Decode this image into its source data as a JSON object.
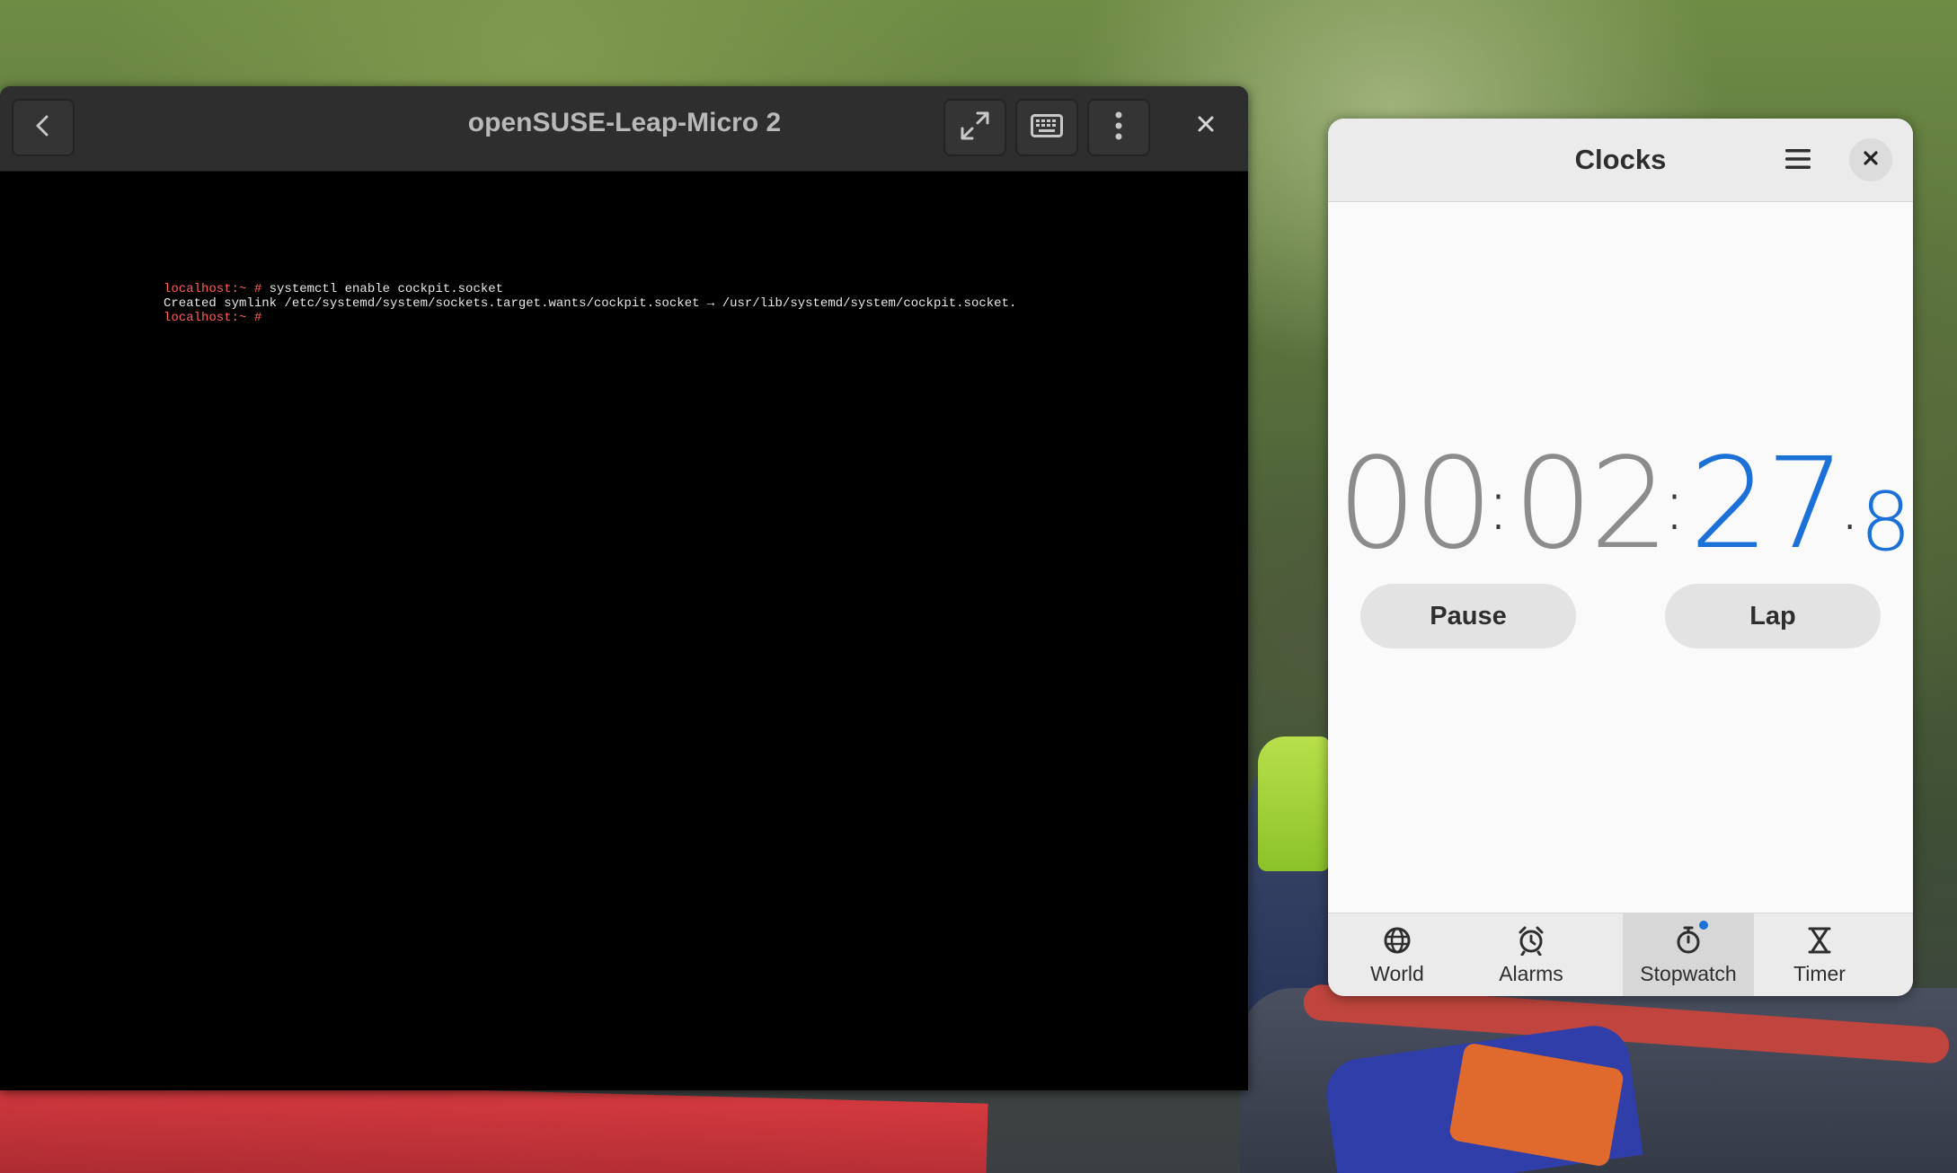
{
  "vm_window": {
    "title": "openSUSE-Leap-Micro 2",
    "terminal": {
      "line1_prompt": "localhost:~ #",
      "line1_command": " systemctl enable cockpit.socket",
      "line2": "Created symlink /etc/systemd/system/sockets.target.wants/cockpit.socket → /usr/lib/systemd/system/cockpit.socket.",
      "line3_prompt": "localhost:~ #"
    },
    "icons": {
      "back": "chevron-left-icon",
      "fullscreen": "fullscreen-icon",
      "keyboard": "keyboard-icon",
      "menu": "kebab-menu-icon",
      "close": "close-icon"
    }
  },
  "clocks": {
    "title": "Clocks",
    "stopwatch": {
      "hours": "00",
      "minutes": "02",
      "seconds": "27",
      "tenths": "8",
      "sep1": ":",
      "sep2": ":",
      "dot": "."
    },
    "pause_label": "Pause",
    "lap_label": "Lap",
    "tabs": [
      {
        "label": "World",
        "icon": "globe-icon"
      },
      {
        "label": "Alarms",
        "icon": "alarm-clock-icon"
      },
      {
        "label": "Stopwatch",
        "icon": "stopwatch-icon",
        "active": true
      },
      {
        "label": "Timer",
        "icon": "hourglass-icon"
      }
    ],
    "colors": {
      "accent": "#1c71d8",
      "inactive_digits": "#8c8c8c"
    }
  }
}
